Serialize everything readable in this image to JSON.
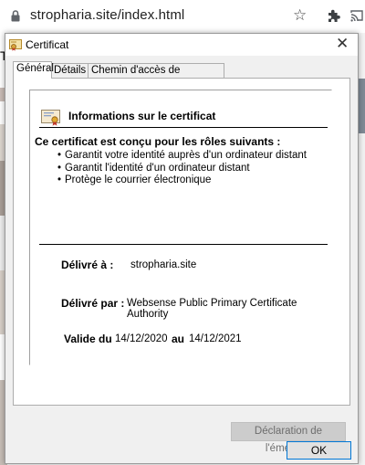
{
  "browser": {
    "url": "stropharia.site/index.html",
    "bg_letter": "T"
  },
  "dialog": {
    "title": "Certificat",
    "tabs": [
      "Général",
      "Détails",
      "Chemin d'accès de certification"
    ],
    "active_tab": "Général",
    "info_title": "Informations sur le certificat",
    "purpose_heading": "Ce certificat est conçu pour les rôles suivants :",
    "purposes": [
      "Garantit votre identité auprès d'un ordinateur distant",
      "Garantit l'identité d'un ordinateur distant",
      "Protège le courrier électronique"
    ],
    "issued_to_label": "Délivré à :",
    "issued_to_value": "stropharia.site",
    "issued_by_label": "Délivré par :",
    "issued_by_value": "Websense Public Primary Certificate Authority",
    "valid_from_label": "Valide du",
    "valid_from_value": "14/12/2020",
    "valid_to_label": "au",
    "valid_to_value": "14/12/2021",
    "issuer_statement_button": "Déclaration de l'émetteur",
    "ok_button": "OK"
  },
  "colors": {
    "focus_border": "#0078d7",
    "dialog_bg": "#f0f0f0",
    "disabled_text": "#6d6d6d"
  },
  "icons": {
    "lock": "lock-icon",
    "star": "star-icon",
    "extensions": "puzzle-icon",
    "cast": "cast-icon",
    "certificate": "certificate-icon",
    "close": "close-icon"
  }
}
